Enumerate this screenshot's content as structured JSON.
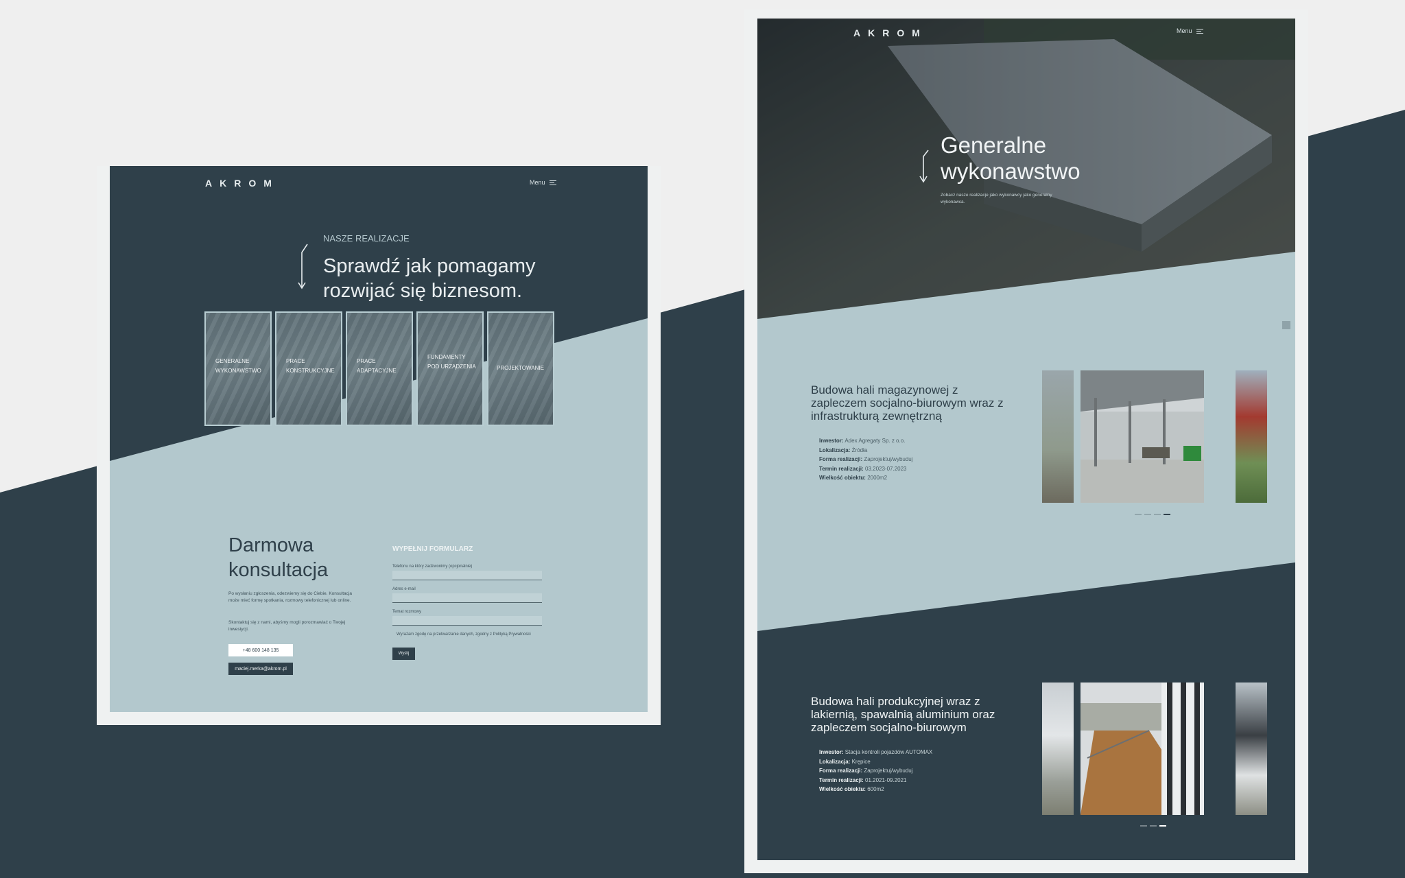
{
  "left_page": {
    "brand": "AKROM",
    "menu_label": "Menu",
    "eyebrow": "NASZE REALIZACJE",
    "hero_title": "Sprawdź jak pomagamy rozwijać się biznesom.",
    "tiles": [
      {
        "label": "GENERALNE WYKONAWSTWO"
      },
      {
        "label": "PRACE KONSTRUKCYJNE"
      },
      {
        "label": "PRACE ADAPTACYJNE"
      },
      {
        "label": "FUNDAMENTY POD URZĄDZENIA"
      },
      {
        "label": "PROJEKTOWANIE"
      }
    ],
    "consult": {
      "title": "Darmowa konsultacja",
      "p1": "Po wysłaniu zgłoszenia, odezwiemy się do Ciebie. Konsultacja może mieć formę spotkania, rozmowy telefonicznej lub online.",
      "p2": "Skontaktuj się z nami, abyśmy mogli porozmawiać o Twojej inwestycji.",
      "phone": "+48 600 148 135",
      "email": "maciej.merka@akrom.pl"
    },
    "form": {
      "title": "WYPEŁNIJ FORMULARZ",
      "phone_label": "Telefonu na który zadzwonimy (opcjonalnie)",
      "email_label": "Adres e-mail",
      "topic_label": "Temat rozmowy",
      "consent": "Wyrażam zgodę na przetwarzanie danych, zgodny z Polityką Prywatności",
      "send_label": "Wyślij"
    }
  },
  "right_page": {
    "brand": "AKROM",
    "menu_label": "Menu",
    "hero_title": "Generalne wykonawstwo",
    "hero_sub": "Zobacz nasze realizacje jako wykonawcy jako generalny wykonawca.",
    "projects": [
      {
        "title": "Budowa hali magazynowej z zapleczem socjalno-biurowym wraz z infrastrukturą zewnętrzną",
        "investor_label": "Inwestor:",
        "investor": "Adex Agregaty Sp. z o.o.",
        "location_label": "Lokalizacja:",
        "location": "Źródła",
        "form_label": "Forma realizacji:",
        "form": "Zaprojektuj/wybuduj",
        "term_label": "Termin realizacji:",
        "term": "03.2023-07.2023",
        "size_label": "Wielkość obiektu:",
        "size": "2000m2"
      },
      {
        "title": "Budowa hali produkcyjnej wraz z lakiernią, spawalnią aluminium oraz zapleczem socjalno-biurowym",
        "investor_label": "Inwestor:",
        "investor": "Stacja kontroli pojazdów AUTOMAX",
        "location_label": "Lokalizacja:",
        "location": "Krępice",
        "form_label": "Forma realizacji:",
        "form": "Zaprojektuj/wybuduj",
        "term_label": "Termin realizacji:",
        "term": "01.2021-09.2021",
        "size_label": "Wielkość obiektu:",
        "size": "600m2"
      }
    ]
  },
  "colors": {
    "dark": "#2f404a",
    "light": "#b3c8cd",
    "frame": "#eff1f1",
    "background": "#efefef"
  }
}
